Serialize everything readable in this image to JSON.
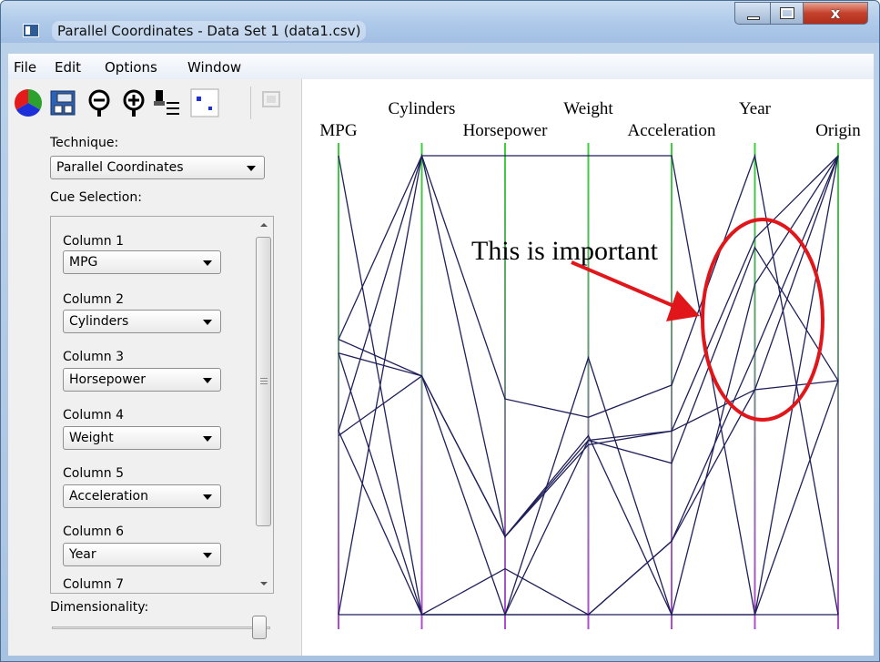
{
  "window": {
    "title": "Parallel Coordinates - Data Set 1 (data1.csv)",
    "close_glyph": "x"
  },
  "menu": [
    "File",
    "Edit",
    "Options",
    "Window"
  ],
  "toolbar": {
    "icons": [
      "color-wheel-icon",
      "properties-icon",
      "zoom-out-icon",
      "zoom-in-icon",
      "brush-icon",
      "point-select-icon",
      "disabled-tool-icon"
    ]
  },
  "sidebar": {
    "technique_label": "Technique:",
    "technique_value": "Parallel Coordinates",
    "cue_label": "Cue Selection:",
    "columns": [
      {
        "label": "Column 1",
        "value": "MPG"
      },
      {
        "label": "Column 2",
        "value": "Cylinders"
      },
      {
        "label": "Column 3",
        "value": "Horsepower"
      },
      {
        "label": "Column 4",
        "value": "Weight"
      },
      {
        "label": "Column 5",
        "value": "Acceleration"
      },
      {
        "label": "Column 6",
        "value": "Year"
      },
      {
        "label": "Column 7",
        "value": ""
      }
    ],
    "dimensionality_label": "Dimensionality:",
    "dimensionality_value": 1.0
  },
  "chart_data": {
    "type": "parallel_coordinates",
    "axes": [
      "MPG",
      "Cylinders",
      "Horsepower",
      "Weight",
      "Acceleration",
      "Year",
      "Origin"
    ],
    "value_scale": "normalized 0 (bottom) to 1 (top)",
    "lines": [
      [
        1.0,
        0.0,
        0.0,
        0.56,
        0.0,
        0.0,
        0.0
      ],
      [
        0.0,
        1.0,
        1.0,
        1.0,
        1.0,
        0.0,
        1.0
      ],
      [
        0.6,
        1.0,
        0.47,
        0.43,
        0.5,
        1.0,
        0.0
      ],
      [
        0.4,
        0.0,
        0.0,
        0.0,
        0.16,
        0.57,
        1.0
      ],
      [
        0.6,
        0.52,
        0.17,
        0.39,
        0.0,
        0.72,
        1.0
      ],
      [
        0.57,
        0.52,
        0.17,
        0.38,
        0.33,
        0.8,
        0.51
      ],
      [
        0.4,
        1.0,
        0.17,
        0.37,
        0.4,
        0.82,
        1.0
      ],
      [
        0.0,
        0.0,
        0.1,
        0.0,
        0.16,
        0.49,
        0.51
      ],
      [
        0.39,
        0.52,
        0.0,
        0.0,
        0.0,
        0.0,
        0.51
      ],
      [
        0.57,
        0.0,
        0.0,
        0.38,
        0.4,
        0.49,
        1.0
      ]
    ],
    "line_color": "#1f1f5a",
    "axis_color_top": "#3ad23a",
    "axis_color_bottom": "#b04ad4",
    "annotation": {
      "text": "This is important",
      "color": "#e0161b"
    }
  }
}
